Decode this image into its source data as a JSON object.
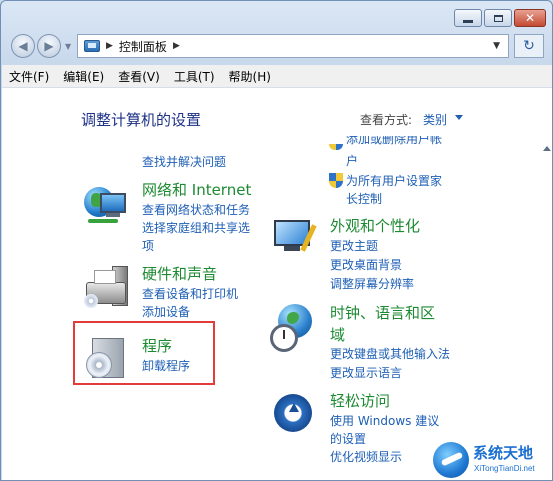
{
  "window": {
    "address_path": "控制面板"
  },
  "menubar": [
    "文件(F)",
    "编辑(E)",
    "查看(V)",
    "工具(T)",
    "帮助(H)"
  ],
  "page": {
    "title": "调整计算机的设置",
    "view_label": "查看方式:",
    "view_value": "类别"
  },
  "left": {
    "top_link": "查找并解决问题",
    "network": {
      "heading": "网络和 Internet",
      "links": [
        "查看网络状态和任务",
        "选择家庭组和共享选",
        "项"
      ]
    },
    "hardware": {
      "heading": "硬件和声音",
      "links": [
        "查看设备和打印机",
        "添加设备"
      ]
    },
    "programs": {
      "heading": "程序",
      "links": [
        "卸载程序"
      ]
    }
  },
  "right": {
    "top_partial": "户",
    "top_partial_above": "添加或删除用户帐",
    "parental": [
      "为所有用户设置家",
      "长控制"
    ],
    "appearance": {
      "heading": "外观和个性化",
      "links": [
        "更改主题",
        "更改桌面背景",
        "调整屏幕分辨率"
      ]
    },
    "clock": {
      "heading_line1": "时钟、语言和区",
      "heading_line2": "域",
      "links": [
        "更改键盘或其他输入法",
        "更改显示语言"
      ]
    },
    "ease": {
      "heading": "轻松访问",
      "links": [
        "使用 Windows 建议",
        "的设置",
        "优化视频显示"
      ]
    }
  },
  "watermark": {
    "title": "系统天地",
    "subtitle": "XiTongTianDi.net"
  },
  "colors": {
    "link": "#1e5fb5",
    "heading": "#1d8a32",
    "title": "#1e3287",
    "highlight": "#e33b3b"
  }
}
